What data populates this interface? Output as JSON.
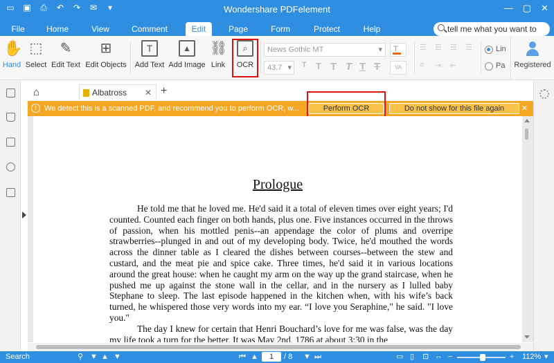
{
  "app": {
    "title": "Wondershare PDFelement"
  },
  "menu": {
    "tabs": [
      "File",
      "Home",
      "View",
      "Comment",
      "Edit",
      "Page",
      "Form",
      "Protect",
      "Help"
    ],
    "active": "Edit",
    "search_placeholder": "tell me what you want to"
  },
  "ribbon": {
    "tools": [
      "Hand",
      "Select",
      "Edit Text",
      "Edit Objects",
      "Add Text",
      "Add Image",
      "Link",
      "OCR"
    ],
    "font_name": "News Gothic MT",
    "font_size": "43.7",
    "radio_1": "Lin",
    "radio_2": "Pa",
    "account": "Registered"
  },
  "document": {
    "tab_name": "Albatross",
    "notice": {
      "message": "We detect this is a scanned PDF, and recommend you to perform OCR, w...",
      "perform_ocr": "Perform OCR",
      "dont_show": "Do not show for this file again"
    },
    "heading": "Prologue",
    "paragraph_1": "He told me that he loved me. He'd said it a total of eleven times over eight years; I'd counted. Counted each finger on both hands, plus one. Five instances occurred in the throws of passion, when his mottled penis--an appendage the color of plums and overripe strawberries--plunged in and out of my developing body. Twice, he'd mouthed the words across the dinner table as I cleared the dishes between courses--between the stew and custard, and the meat pie and spice cake. Three times, he'd said it in various locations around the great house: when he caught my arm on the way up the grand staircase, when he pushed me up against the stone wall in the cellar, and in the nursery as I lulled baby Stephane to sleep. The last episode happened in the kitchen when, with his wife’s back turned, he whispered those very words into my ear. “I love you Seraphine,\" he said. \"I love you.\"",
    "paragraph_2": "The day I knew for certain that Henri Bouchard’s love for me was false, was the day my life took a turn for the better. It was May 2nd, 1786 at about 3:30 in the"
  },
  "status": {
    "search_label": "Search",
    "current_page": "1",
    "page_total": "/ 8",
    "zoom": "112%",
    "zoom_fraction": 0.5
  }
}
